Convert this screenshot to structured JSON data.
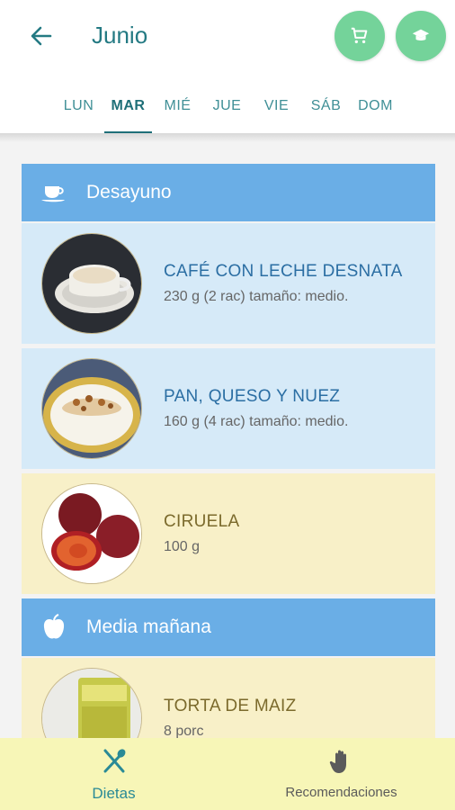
{
  "header": {
    "title": "Junio",
    "colors": {
      "accent": "#247a83",
      "fab": "#74d39a",
      "section": "#6aaee6"
    }
  },
  "days": [
    {
      "label": "LUN",
      "active": false
    },
    {
      "label": "MAR",
      "active": true
    },
    {
      "label": "MIÉ",
      "active": false
    },
    {
      "label": "JUE",
      "active": false
    },
    {
      "label": "VIE",
      "active": false
    },
    {
      "label": "SÁB",
      "active": false
    },
    {
      "label": "DOM",
      "active": false
    }
  ],
  "sections": [
    {
      "title": "Desayuno",
      "icon": "coffee-cup-icon",
      "items": [
        {
          "name": "CAFÉ CON LECHE DESNATA",
          "qty": "230 g (2 rac) tamaño: medio.",
          "style": "blue",
          "image": "coffee-image"
        },
        {
          "name": "PAN, QUESO Y NUEZ",
          "qty": "160 g (4 rac) tamaño: medio.",
          "style": "blue",
          "image": "bread-cheese-nut-image"
        },
        {
          "name": "CIRUELA",
          "qty": "100 g",
          "style": "yellow",
          "image": "plum-image"
        }
      ]
    },
    {
      "title": "Media mañana",
      "icon": "apple-icon",
      "items": [
        {
          "name": "TORTA DE MAIZ",
          "qty": "8 porc",
          "style": "yellow",
          "image": "corn-cake-image"
        }
      ]
    }
  ],
  "bottom_nav": {
    "dietas": "Dietas",
    "recomendaciones": "Recomendaciones"
  }
}
